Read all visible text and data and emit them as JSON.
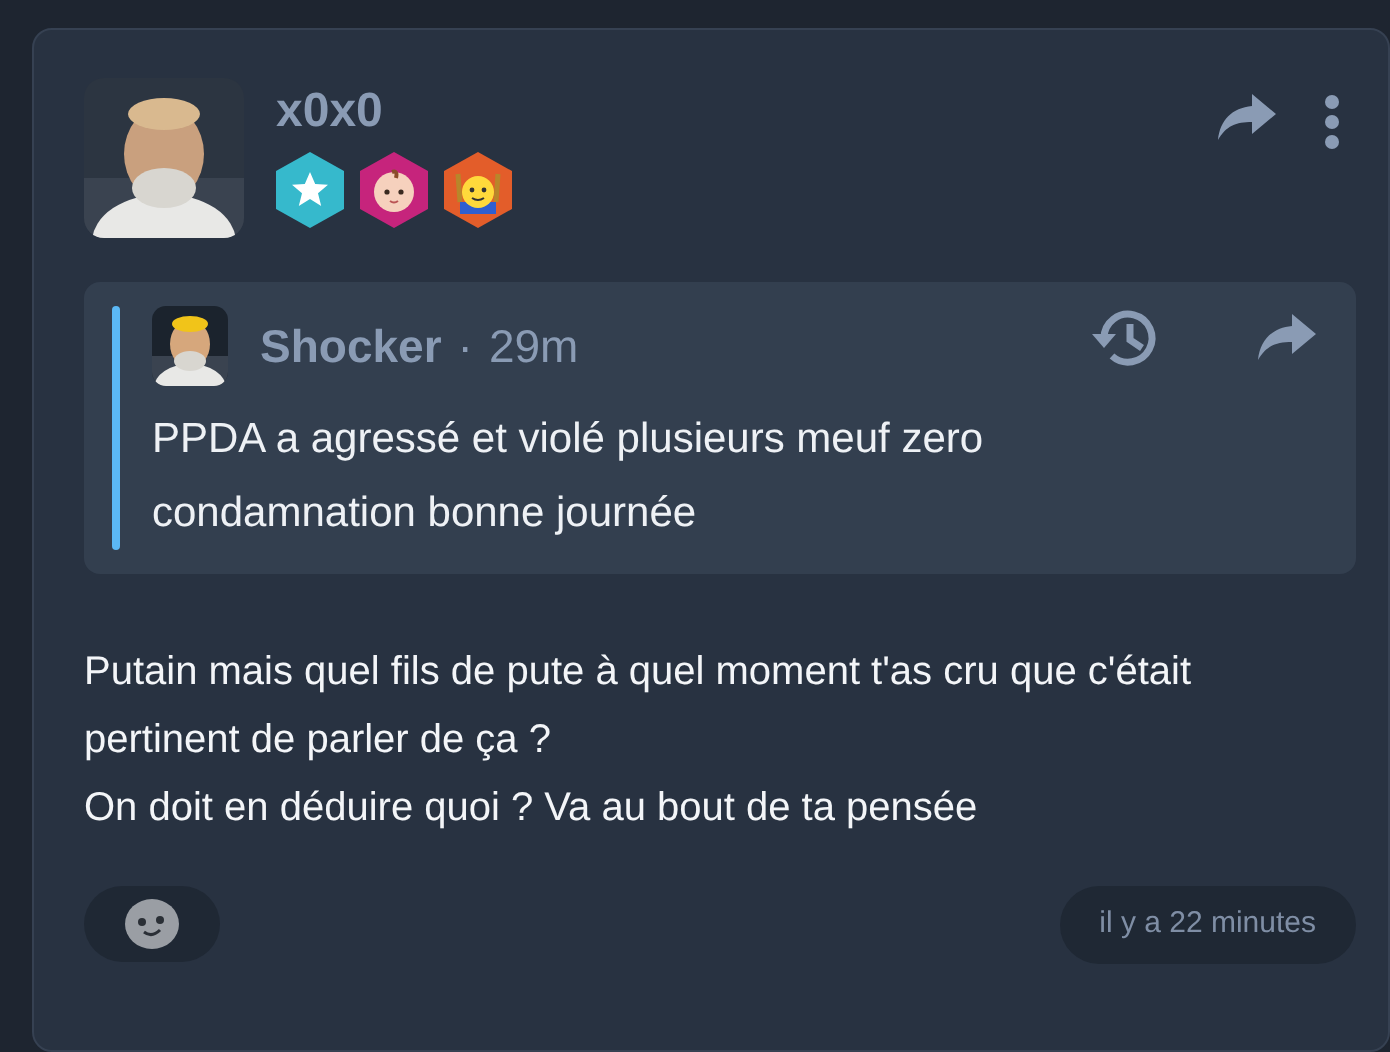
{
  "post": {
    "author": "x0x0",
    "avatar": {
      "kind": "picture"
    },
    "badges": [
      {
        "kind": "star",
        "color": "#36b9cc"
      },
      {
        "kind": "baby",
        "color": "#c6247c"
      },
      {
        "kind": "smiley",
        "color": "#e35d2a"
      }
    ],
    "quote": {
      "author": "Shocker",
      "separator": "·",
      "time": "29m",
      "text": "PPDA a agressé et violé plusieurs meuf zero condamnation bonne journée"
    },
    "body": [
      "Putain mais quel fils de pute à quel moment t'as cru que c'était pertinent de parler de ça ?",
      "On doit en déduire quoi ? Va au bout de ta pensée"
    ],
    "timestamp": "il y a 22 minutes"
  }
}
